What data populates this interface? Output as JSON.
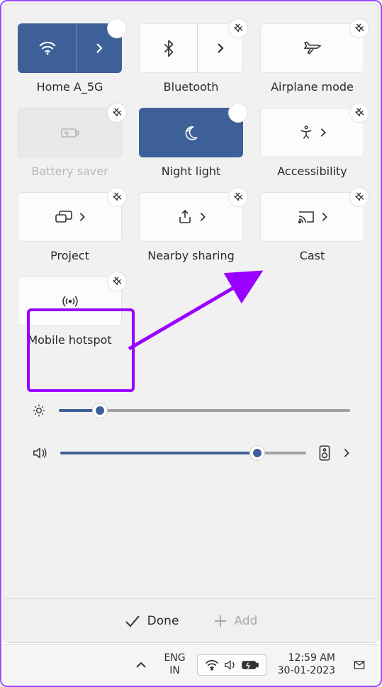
{
  "tiles": {
    "wifi": {
      "label": "Home A_5G",
      "active": true,
      "expandable": true
    },
    "bluetooth": {
      "label": "Bluetooth",
      "active": false,
      "expandable": true
    },
    "airplane": {
      "label": "Airplane mode",
      "active": false,
      "expandable": false
    },
    "battery_saver": {
      "label": "Battery saver",
      "active": false,
      "disabled": true,
      "expandable": false
    },
    "night_light": {
      "label": "Night light",
      "active": true,
      "expandable": false
    },
    "accessibility": {
      "label": "Accessibility",
      "active": false,
      "expandable": true
    },
    "project": {
      "label": "Project",
      "active": false,
      "expandable": true
    },
    "nearby_sharing": {
      "label": "Nearby sharing",
      "active": false,
      "expandable": true
    },
    "cast": {
      "label": "Cast",
      "active": false,
      "expandable": true
    },
    "mobile_hotspot": {
      "label": "Mobile hotspot",
      "active": false,
      "expandable": false
    }
  },
  "sliders": {
    "brightness": {
      "value_percent": 14
    },
    "volume": {
      "value_percent": 80
    }
  },
  "footer": {
    "done_label": "Done",
    "add_label": "Add"
  },
  "taskbar": {
    "language_top": "ENG",
    "language_bottom": "IN",
    "time": "12:59 AM",
    "date": "30-01-2023"
  },
  "annotation": {
    "highlight_target": "mobile_hotspot",
    "arrow_to": "cast",
    "color": "#9a00ff"
  }
}
